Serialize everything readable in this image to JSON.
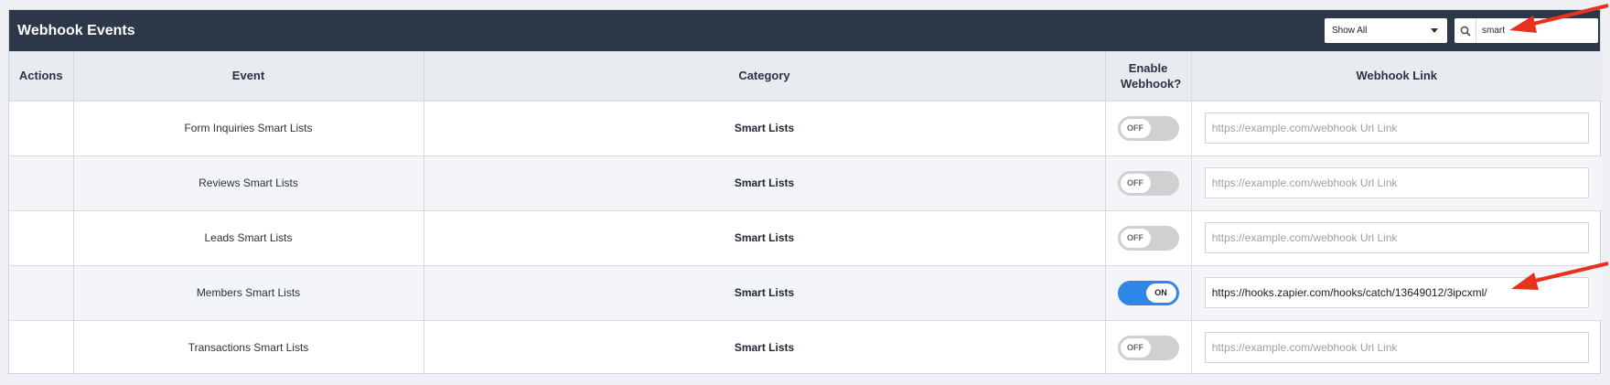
{
  "header": {
    "title": "Webhook Events",
    "filter_selected": "Show All",
    "search_value": "smart"
  },
  "table": {
    "columns": [
      "Actions",
      "Event",
      "Category",
      "Enable Webhook?",
      "Webhook Link"
    ],
    "url_placeholder": "https://example.com/webhook Url Link",
    "rows": [
      {
        "event": "Form Inquiries Smart Lists",
        "category": "Smart Lists",
        "toggle": "OFF",
        "link": ""
      },
      {
        "event": "Reviews Smart Lists",
        "category": "Smart Lists",
        "toggle": "OFF",
        "link": ""
      },
      {
        "event": "Leads Smart Lists",
        "category": "Smart Lists",
        "toggle": "OFF",
        "link": ""
      },
      {
        "event": "Members Smart Lists",
        "category": "Smart Lists",
        "toggle": "ON",
        "link": "https://hooks.zapier.com/hooks/catch/13649012/3ipcxml/"
      },
      {
        "event": "Transactions Smart Lists",
        "category": "Smart Lists",
        "toggle": "OFF",
        "link": ""
      }
    ]
  },
  "colors": {
    "header_bg": "#2c3749",
    "toggle_on": "#2e86e6",
    "toggle_off": "#cfd0d2",
    "annotation_arrow": "#e8321e"
  }
}
